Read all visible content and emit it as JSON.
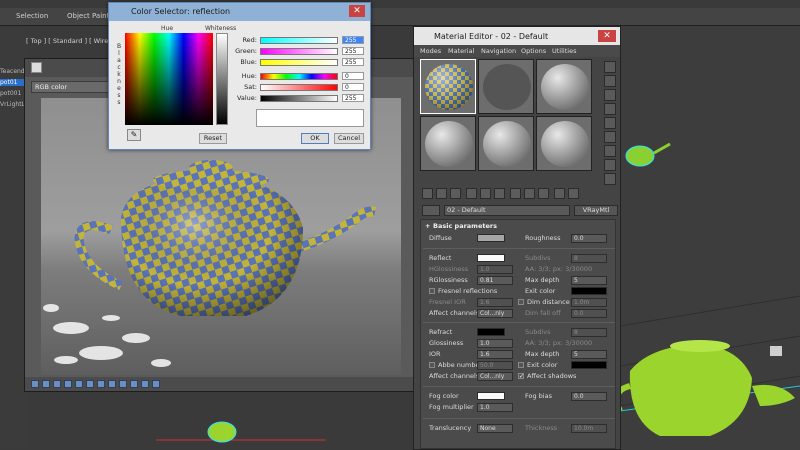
{
  "topbar": {
    "selection": "Selection",
    "object_paint": "Object Paint"
  },
  "viewport": {
    "label": "[ Top ] [ Standard ] [ Wirefr"
  },
  "left_strip": [
    "Teacend",
    "pot01",
    "pot001",
    "VrLightL"
  ],
  "render_frame": {
    "channel": "RGB color"
  },
  "color_selector": {
    "title": "Color Selector: reflection",
    "hue_label": "Hue",
    "whiteness_label": "Whiteness",
    "blackness_label": "Blackness",
    "rows": [
      {
        "label": "Red:",
        "value": "255"
      },
      {
        "label": "Green:",
        "value": "255"
      },
      {
        "label": "Blue:",
        "value": "255"
      },
      {
        "label": "Hue:",
        "value": "0"
      },
      {
        "label": "Sat:",
        "value": "0"
      },
      {
        "label": "Value:",
        "value": "255"
      }
    ],
    "reset": "Reset",
    "ok": "OK",
    "cancel": "Cancel"
  },
  "material_editor": {
    "title": "Material Editor - 02 - Default",
    "menu": [
      "Modes",
      "Material",
      "Navigation",
      "Options",
      "Utilities"
    ],
    "material_name": "02 - Default",
    "material_type": "VRayMtl",
    "basic_params_header": "Basic parameters",
    "diffuse": {
      "label": "Diffuse",
      "roughness_label": "Roughness",
      "roughness": "0.0"
    },
    "reflect": {
      "label": "Reflect",
      "subdivs_label": "Subdivs",
      "subdivs": "8",
      "hglossiness_label": "HGlossiness",
      "hglossiness": "1.0",
      "aa_text": "AA: 3/3; px: 3/30000",
      "rglossiness_label": "RGlossiness",
      "rglossiness": "0.81",
      "max_depth_label": "Max depth",
      "max_depth": "5",
      "fresnel_label": "Fresnel reflections",
      "exit_color_label": "Exit color",
      "fresnel_ior_label": "Fresnel IOR",
      "fresnel_ior": "1.6",
      "dim_distance_label": "Dim distance",
      "dim_distance": "1.0m",
      "affect_channels_label": "Affect channels",
      "affect_channels": "Col...nly",
      "dim_falloff_label": "Dim fall off",
      "dim_falloff": "0.0"
    },
    "refract": {
      "label": "Refract",
      "subdivs_label": "Subdivs",
      "subdivs": "8",
      "glossiness_label": "Glossiness",
      "glossiness": "1.0",
      "aa_text": "AA: 3/3; px: 3/30000",
      "ior_label": "IOR",
      "ior": "1.6",
      "max_depth_label": "Max depth",
      "max_depth": "5",
      "abbe_label": "Abbe number",
      "abbe": "50.0",
      "exit_color_label": "Exit color",
      "affect_channels_label": "Affect channels",
      "affect_channels": "Col...nly",
      "affect_shadows_label": "Affect shadows"
    },
    "fog": {
      "color_label": "Fog color",
      "bias_label": "Fog bias",
      "bias": "0.0",
      "multiplier_label": "Fog multiplier",
      "multiplier": "1.0"
    },
    "translucency": {
      "label": "Translucency",
      "value": "None",
      "thickness_label": "Thickness",
      "thickness": "10.0m"
    }
  },
  "colors": {
    "window_blue": "#8fb1d6",
    "accent": "#3a86ff",
    "teapot_green": "#9ad42c"
  }
}
